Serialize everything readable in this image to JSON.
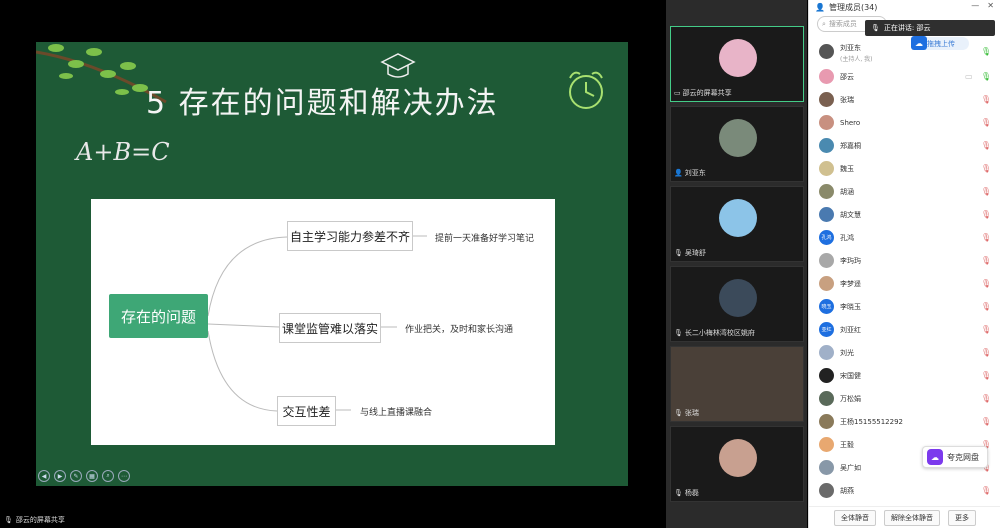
{
  "share": {
    "slide_title": "5 存在的问题和解决办法",
    "formula": "A+B=C",
    "share_label": "邵云的屏幕共享"
  },
  "mindmap": {
    "root": "存在的问题",
    "nodes": [
      {
        "label": "自主学习能力参差不齐",
        "note": "提前一天准备好学习笔记"
      },
      {
        "label": "课堂监管难以落实",
        "note": "作业把关，及时和家长沟通"
      },
      {
        "label": "交互性差",
        "note": "与线上直播课融合"
      }
    ]
  },
  "videos": [
    {
      "label": "邵云的屏幕共享",
      "color": "#e8b4c8"
    },
    {
      "label": "刘亚东",
      "color": "#7a8a7a"
    },
    {
      "label": "吴琦舒",
      "color": "#8cc4e8"
    },
    {
      "label": "长二小梅林湾校区姚府",
      "color": "#3b4a5a"
    },
    {
      "label": "张瑞",
      "color": "#6a6058"
    },
    {
      "label": "杨磊",
      "color": "#c8a090"
    }
  ],
  "panel": {
    "title": "管理成员(34)",
    "search_placeholder": "搜索成员",
    "speaking": "正在讲话: 邵云",
    "upload": "拖拽上传",
    "members": [
      {
        "name": "刘亚东",
        "sub": "(主持人, 我)",
        "color": "#555",
        "mic": "on"
      },
      {
        "name": "邵云",
        "sub": "",
        "color": "#e89ab0",
        "mic": "on"
      },
      {
        "name": "张瑞",
        "sub": "",
        "color": "#7a6050",
        "mic": "off"
      },
      {
        "name": "Shero",
        "sub": "",
        "color": "#c89080",
        "mic": "off"
      },
      {
        "name": "郑嘉桐",
        "sub": "",
        "color": "#4a8ab0",
        "mic": "off"
      },
      {
        "name": "魏玉",
        "sub": "",
        "color": "#d0c090",
        "mic": "off"
      },
      {
        "name": "胡涵",
        "sub": "",
        "color": "#8a8a6a",
        "mic": "off"
      },
      {
        "name": "胡文慧",
        "sub": "",
        "color": "#4a7ab0",
        "mic": "off"
      },
      {
        "name": "孔鸿",
        "sub": "",
        "color": "#1e6fe0",
        "mic": "off",
        "avatar_text": "孔鸿"
      },
      {
        "name": "李玙玙",
        "sub": "",
        "color": "#a8a8a8",
        "mic": "off"
      },
      {
        "name": "李梦遥",
        "sub": "",
        "color": "#c8a080",
        "mic": "off"
      },
      {
        "name": "李晓玉",
        "sub": "",
        "color": "#1e6fe0",
        "mic": "off",
        "avatar_text": "晓玉"
      },
      {
        "name": "刘亚红",
        "sub": "",
        "color": "#1e6fe0",
        "mic": "off",
        "avatar_text": "亚红"
      },
      {
        "name": "刘光",
        "sub": "",
        "color": "#a0b0c8",
        "mic": "off"
      },
      {
        "name": "宋国健",
        "sub": "",
        "color": "#222",
        "mic": "off"
      },
      {
        "name": "万松娟",
        "sub": "",
        "color": "#5a6a5a",
        "mic": "off"
      },
      {
        "name": "王杨15155512292",
        "sub": "",
        "color": "#8a7a5a",
        "mic": "off"
      },
      {
        "name": "王毅",
        "sub": "",
        "color": "#e8a870",
        "mic": "off"
      },
      {
        "name": "吴广如",
        "sub": "",
        "color": "#8898a8",
        "mic": "off"
      },
      {
        "name": "胡燕",
        "sub": "",
        "color": "#6a6a6a",
        "mic": "off"
      }
    ],
    "netdisk": "夸克网盘",
    "footer": [
      "全体静音",
      "解除全体静音",
      "更多"
    ]
  },
  "colors": {
    "chalkboard": "#1e5a36",
    "accent_green": "#3ea776",
    "blue": "#1e6fe0"
  }
}
